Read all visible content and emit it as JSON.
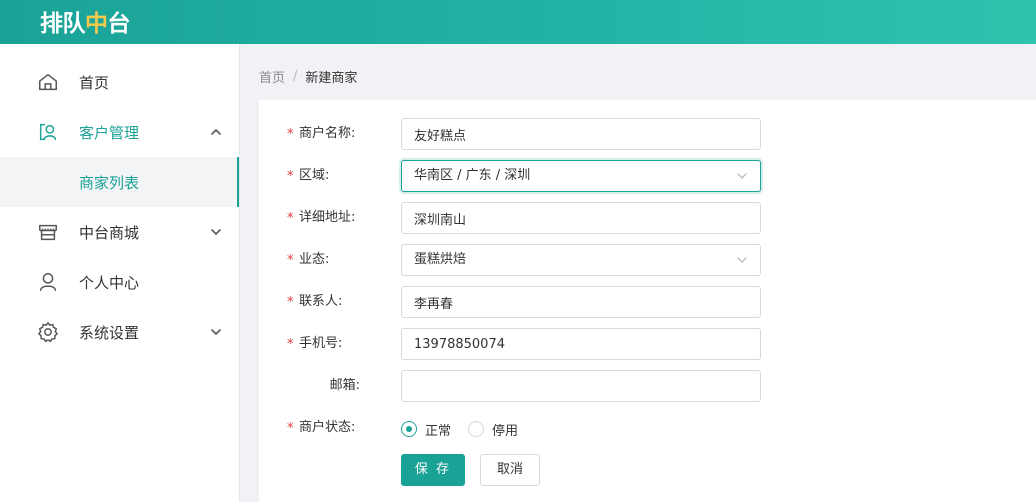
{
  "app": {
    "logo_part1": "排队",
    "logo_part2": "中",
    "logo_part3": "台"
  },
  "sidebar": {
    "items": [
      {
        "label": "首页",
        "icon": "home-icon",
        "expanded": false,
        "active": false
      },
      {
        "label": "客户管理",
        "icon": "customer-icon",
        "expanded": true,
        "active": true,
        "children": [
          {
            "label": "商家列表",
            "active": true
          }
        ]
      },
      {
        "label": "中台商城",
        "icon": "store-icon",
        "expanded": false,
        "active": false
      },
      {
        "label": "个人中心",
        "icon": "user-icon",
        "expanded": false,
        "active": false
      },
      {
        "label": "系统设置",
        "icon": "settings-icon",
        "expanded": false,
        "active": false
      }
    ]
  },
  "breadcrumb": {
    "home": "首页",
    "separator": "/",
    "current": "新建商家"
  },
  "form": {
    "merchant_name": {
      "label": "商户名称:",
      "value": "友好糕点",
      "required": true
    },
    "region": {
      "label": "区域:",
      "value": "华南区 / 广东 / 深圳",
      "required": true
    },
    "address": {
      "label": "详细地址:",
      "value": "深圳南山",
      "required": true
    },
    "business_type": {
      "label": "业态:",
      "value": "蛋糕烘焙",
      "required": true
    },
    "contact": {
      "label": "联系人:",
      "value": "李再春",
      "required": true
    },
    "phone": {
      "label": "手机号:",
      "value": "13978850074",
      "required": true
    },
    "email": {
      "label": "邮箱:",
      "value": "",
      "required": false
    },
    "status": {
      "label": "商户状态:",
      "required": true,
      "options": [
        "正常",
        "停用"
      ],
      "selected": "正常"
    },
    "required_mark": "*",
    "save_label": "保 存",
    "cancel_label": "取消"
  },
  "colors": {
    "primary": "#1aa297",
    "header_gradient_start": "#1aa297",
    "header_gradient_end": "#2fc2ad",
    "logo_accent": "#f2c94c",
    "required": "#e4393c"
  }
}
